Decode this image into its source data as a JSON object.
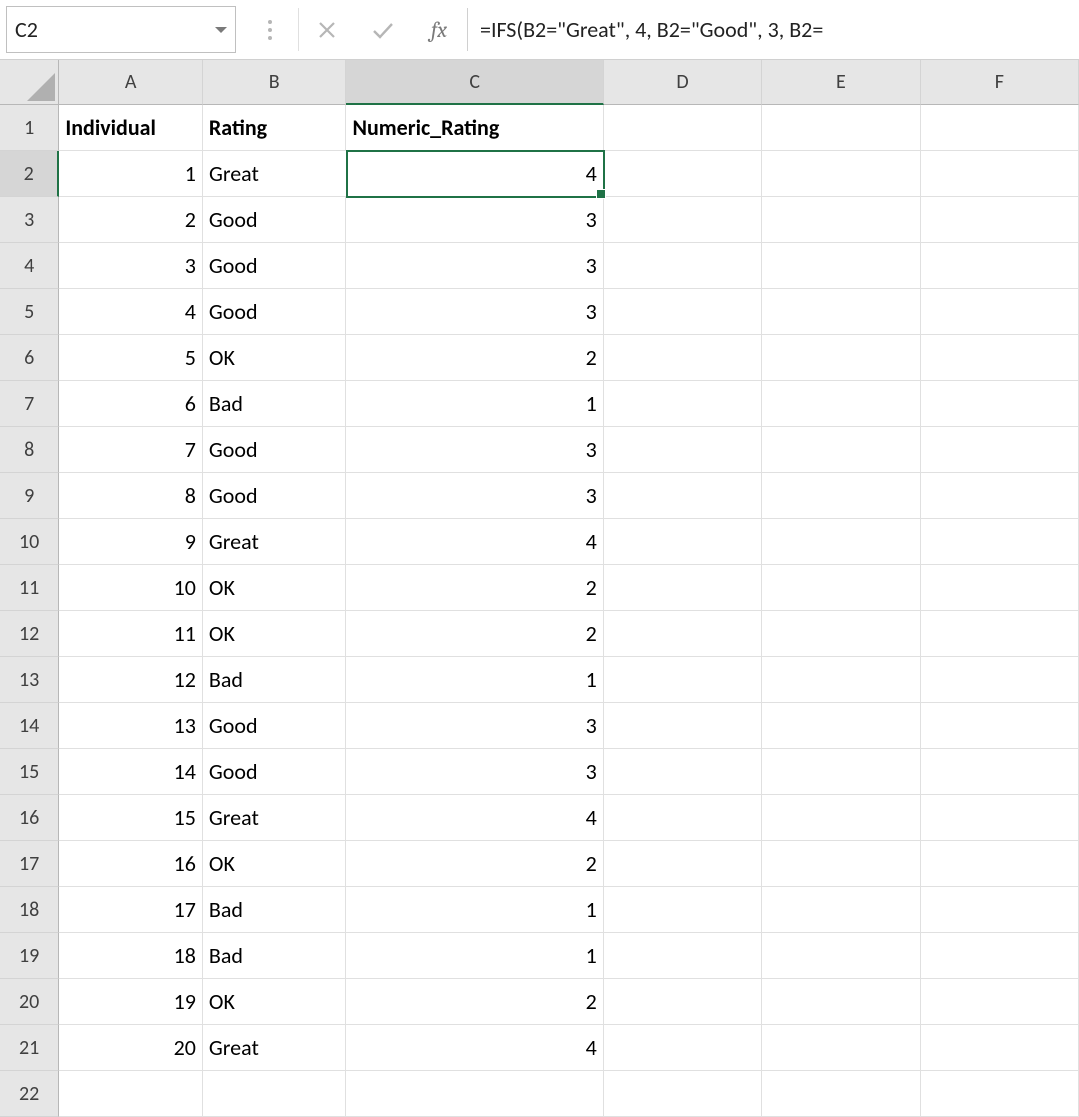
{
  "formulaBar": {
    "nameBox": "C2",
    "fxLabel": "fx",
    "formula": "=IFS(B2=\"Great\", 4, B2=\"Good\", 3, B2="
  },
  "columns": [
    {
      "letter": "A",
      "widthClass": "w-a",
      "selected": false
    },
    {
      "letter": "B",
      "widthClass": "w-b",
      "selected": false
    },
    {
      "letter": "C",
      "widthClass": "w-c",
      "selected": true
    },
    {
      "letter": "D",
      "widthClass": "w-d",
      "selected": false
    },
    {
      "letter": "E",
      "widthClass": "w-e",
      "selected": false
    },
    {
      "letter": "F",
      "widthClass": "w-f",
      "selected": false
    }
  ],
  "headers": {
    "A": "Individual",
    "B": "Rating",
    "C": "Numeric_Rating"
  },
  "rows": [
    {
      "n": 1,
      "A": "Individual",
      "B": "Rating",
      "C": "Numeric_Rating",
      "isHeader": true
    },
    {
      "n": 2,
      "A": "1",
      "B": "Great",
      "C": "4",
      "selected": true
    },
    {
      "n": 3,
      "A": "2",
      "B": "Good",
      "C": "3"
    },
    {
      "n": 4,
      "A": "3",
      "B": "Good",
      "C": "3"
    },
    {
      "n": 5,
      "A": "4",
      "B": "Good",
      "C": "3"
    },
    {
      "n": 6,
      "A": "5",
      "B": "OK",
      "C": "2"
    },
    {
      "n": 7,
      "A": "6",
      "B": "Bad",
      "C": "1"
    },
    {
      "n": 8,
      "A": "7",
      "B": "Good",
      "C": "3"
    },
    {
      "n": 9,
      "A": "8",
      "B": "Good",
      "C": "3"
    },
    {
      "n": 10,
      "A": "9",
      "B": "Great",
      "C": "4"
    },
    {
      "n": 11,
      "A": "10",
      "B": "OK",
      "C": "2"
    },
    {
      "n": 12,
      "A": "11",
      "B": "OK",
      "C": "2"
    },
    {
      "n": 13,
      "A": "12",
      "B": "Bad",
      "C": "1"
    },
    {
      "n": 14,
      "A": "13",
      "B": "Good",
      "C": "3"
    },
    {
      "n": 15,
      "A": "14",
      "B": "Good",
      "C": "3"
    },
    {
      "n": 16,
      "A": "15",
      "B": "Great",
      "C": "4"
    },
    {
      "n": 17,
      "A": "16",
      "B": "OK",
      "C": "2"
    },
    {
      "n": 18,
      "A": "17",
      "B": "Bad",
      "C": "1"
    },
    {
      "n": 19,
      "A": "18",
      "B": "Bad",
      "C": "1"
    },
    {
      "n": 20,
      "A": "19",
      "B": "OK",
      "C": "2"
    },
    {
      "n": 21,
      "A": "20",
      "B": "Great",
      "C": "4"
    },
    {
      "n": 22,
      "A": "",
      "B": "",
      "C": ""
    }
  ],
  "selection": {
    "cell": "C2",
    "row": 2,
    "col": "C"
  }
}
